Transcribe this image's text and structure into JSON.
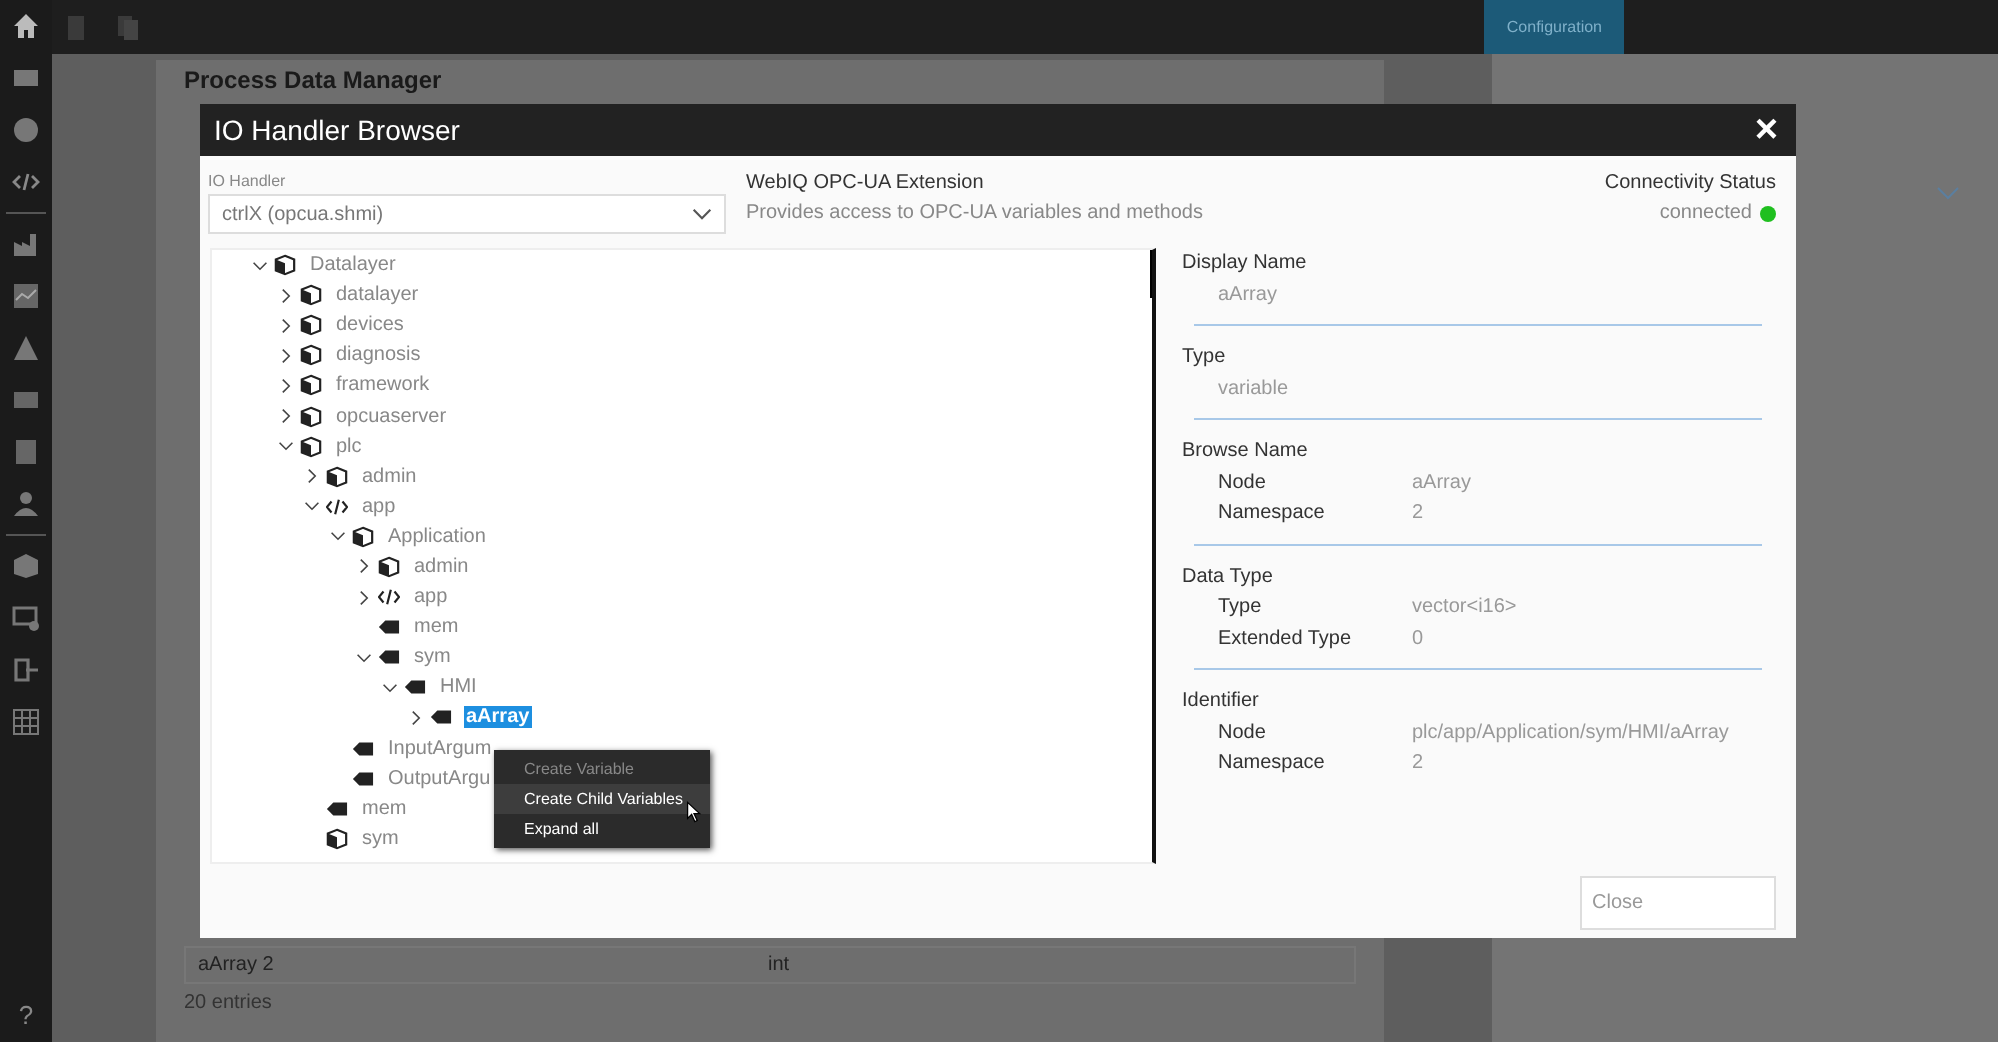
{
  "top_bar": {
    "tab": "Configuration"
  },
  "sidebar": {
    "help": "?"
  },
  "page": {
    "title": "Process Data Manager",
    "table_rows": [
      {
        "name": "aArray 2",
        "type": "int"
      }
    ],
    "entries": "20 entries"
  },
  "dialog": {
    "title": "IO Handler Browser",
    "close": "×",
    "io_handler": {
      "label": "IO Handler",
      "value": "ctrlX (opcua.shmi)"
    },
    "extension": {
      "name": "WebIQ OPC-UA Extension",
      "description": "Provides access to OPC-UA variables and methods"
    },
    "connectivity": {
      "label": "Connectivity Status",
      "value": "connected"
    },
    "tree": [
      {
        "label": "Datalayer",
        "kind": "object",
        "expanded": true,
        "selected": false,
        "children": [
          {
            "label": "datalayer",
            "kind": "object",
            "expanded": false,
            "selected": false
          },
          {
            "label": "devices",
            "kind": "object",
            "expanded": false,
            "selected": false
          },
          {
            "label": "diagnosis",
            "kind": "object",
            "expanded": false,
            "selected": false
          },
          {
            "label": "framework",
            "kind": "object",
            "expanded": false,
            "selected": false
          },
          {
            "label": "opcuaserver",
            "kind": "object",
            "expanded": false,
            "selected": false
          },
          {
            "label": "plc",
            "kind": "object",
            "expanded": true,
            "selected": false,
            "children": [
              {
                "label": "admin",
                "kind": "object",
                "expanded": false,
                "selected": false
              },
              {
                "label": "app",
                "kind": "method",
                "expanded": true,
                "selected": false,
                "children": [
                  {
                    "label": "Application",
                    "kind": "object",
                    "expanded": true,
                    "selected": false,
                    "children": [
                      {
                        "label": "admin",
                        "kind": "object",
                        "expanded": false,
                        "selected": false
                      },
                      {
                        "label": "app",
                        "kind": "method",
                        "expanded": false,
                        "selected": false
                      },
                      {
                        "label": "mem",
                        "kind": "variable",
                        "selected": false
                      },
                      {
                        "label": "sym",
                        "kind": "variable",
                        "expanded": true,
                        "selected": false,
                        "children": [
                          {
                            "label": "HMI",
                            "kind": "variable",
                            "expanded": true,
                            "selected": false,
                            "children": [
                              {
                                "label": "aArray",
                                "kind": "variable",
                                "expanded": false,
                                "selected": true
                              }
                            ]
                          }
                        ]
                      }
                    ]
                  },
                  {
                    "label": "InputArgum",
                    "kind": "variable",
                    "selected": false
                  },
                  {
                    "label": "OutputArgu",
                    "kind": "variable",
                    "selected": false
                  }
                ]
              },
              {
                "label": "mem",
                "kind": "variable",
                "selected": false
              },
              {
                "label": "sym",
                "kind": "object",
                "selected": false
              }
            ]
          }
        ]
      }
    ],
    "context_menu": [
      {
        "label": "Create Variable",
        "disabled": true,
        "selected": false
      },
      {
        "label": "Create Child Variables",
        "disabled": false,
        "selected": true
      },
      {
        "label": "Expand all",
        "disabled": false,
        "selected": false
      }
    ],
    "details": [
      {
        "title": "Display Name",
        "kind": "single",
        "value": "aArray"
      },
      {
        "title": "Type",
        "kind": "single",
        "value": "variable"
      },
      {
        "title": "Browse Name",
        "kind": "pairs",
        "fields": [
          {
            "label": "Node",
            "value": "aArray"
          },
          {
            "label": "Namespace",
            "value": "2"
          }
        ]
      },
      {
        "title": "Data Type",
        "kind": "pairs",
        "fields": [
          {
            "label": "Type",
            "value": "vector<i16>"
          },
          {
            "label": "Extended Type",
            "value": "0"
          }
        ]
      },
      {
        "title": "Identifier",
        "kind": "pairs",
        "fields": [
          {
            "label": "Node",
            "value": "plc/app/Application/sym/HMI/aArray"
          },
          {
            "label": "Namespace",
            "value": "2"
          }
        ]
      }
    ],
    "close_button": "Close"
  }
}
